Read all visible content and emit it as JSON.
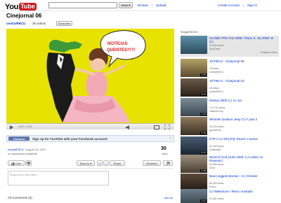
{
  "header": {
    "logo_you": "You",
    "logo_tube": "Tube",
    "search_button": "Search",
    "browse": "Browse",
    "upload": "Upload",
    "create_account": "Create Account",
    "sign_in": "Sign In"
  },
  "video": {
    "title": "Cinejornal 06",
    "channel": "centralFBCU",
    "videos_count": "35 videos",
    "subscribe": "Subscribe",
    "bubble_line1": "NOTÍCIAS",
    "bubble_line2": "QUENTES?!?!",
    "time": "0:00 / 3:39"
  },
  "facebook_bar": {
    "connect": "Connect",
    "text": "Sign up for YouTube with your Facebook account!",
    "close": "×"
  },
  "info": {
    "uploader": "centralFBCU",
    "date": "August 16, 2010",
    "description": "no description available",
    "views_count": "30",
    "views_label": "views"
  },
  "actions": {
    "like": "Like",
    "save_to": "Save to",
    "share": "Share",
    "embed": "<Embed>"
  },
  "comments": {
    "placeholder": "Respond to this video...",
    "title": "All Comments (0)",
    "see_all": "see all"
  },
  "suggestions": {
    "title": "Suggestions",
    "items": [
      {
        "title": "GLOBE PRO FIJI 2008: FINAL K. SLATER vs CJ",
        "views": "22,803 views",
        "channel": "SurfClaire",
        "featured": "Featured Video",
        "duration": ""
      },
      {
        "title": "15°FBCU - Cinejornal 06",
        "views": "15 views",
        "channel": "centralFBCU",
        "featured": "",
        "duration": "3:39"
      },
      {
        "title": "15°FBCU - Cinejornal 03",
        "views": "15 views",
        "channel": "centralFBCU",
        "featured": "",
        "duration": "3:24"
      },
      {
        "title": "Mickey 2000 CJ 1A 1st",
        "views": "170,703 views",
        "channel": "OffshoreGuy",
        "featured": "",
        "duration": "2:43"
      },
      {
        "title": "Wheeler Dealers Jeep CJ-7 part 2",
        "views": "34,224 views",
        "channel": "gpdriver44",
        "featured": "",
        "duration": "9:16"
      },
      {
        "title": "KTP v CJ '08 [3/3]: Reach v Savior",
        "views": "51,004 views",
        "channel": "ChaletsBD",
        "featured": "",
        "duration": "8:10"
      },
      {
        "title": "Word of God (John Wall, CJ Leslie) vs. Ravenscr...",
        "views": "10,906 views",
        "channel": "Shoe",
        "featured": "",
        "duration": "4:48"
      },
      {
        "title": "Bow-Legged Woman - CJ Chenier",
        "views": "55,453 views",
        "channel": "Pnuts",
        "featured": "",
        "duration": "2:55"
      },
      {
        "title": "CJ Wellsmore / Reinz Australia",
        "views": "21,081 views",
        "channel": "",
        "featured": "",
        "duration": "2:41"
      }
    ]
  }
}
